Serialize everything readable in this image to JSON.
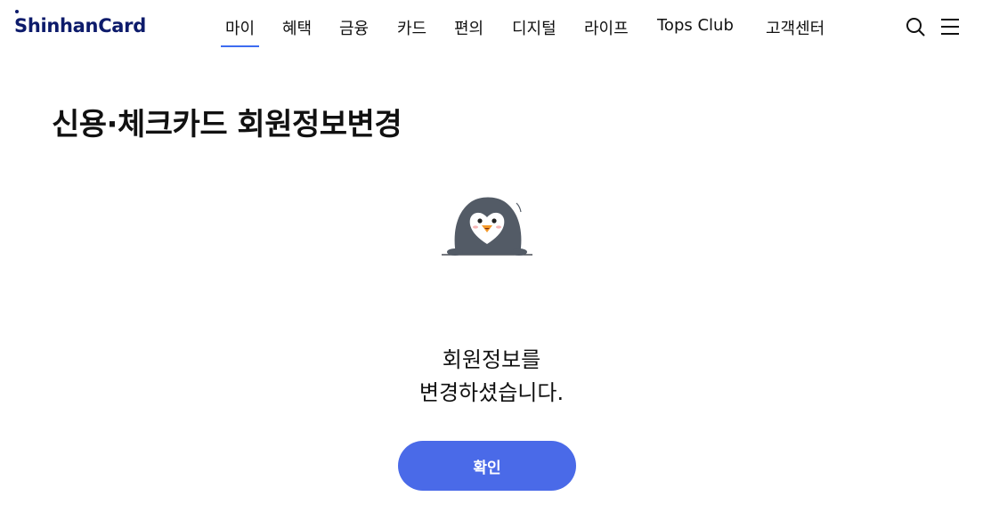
{
  "header": {
    "logo": "ShinhanCard",
    "nav": [
      {
        "label": "마이",
        "active": true
      },
      {
        "label": "혜택",
        "active": false
      },
      {
        "label": "금융",
        "active": false
      },
      {
        "label": "카드",
        "active": false
      },
      {
        "label": "편의",
        "active": false
      },
      {
        "label": "디지털",
        "active": false
      },
      {
        "label": "라이프",
        "active": false
      },
      {
        "label": "Tops Club",
        "active": false
      },
      {
        "label": "고객센터",
        "active": false
      }
    ],
    "icons": [
      "search-icon",
      "menu-icon"
    ]
  },
  "page": {
    "title": "신용·체크카드 회원정보변경",
    "message_line1": "회원정보를",
    "message_line2": "변경하셨습니다.",
    "confirm_label": "확인"
  },
  "colors": {
    "brand": "#0d1b6b",
    "accent": "#4a6ae8",
    "nav_underline": "#3d6cf0"
  }
}
